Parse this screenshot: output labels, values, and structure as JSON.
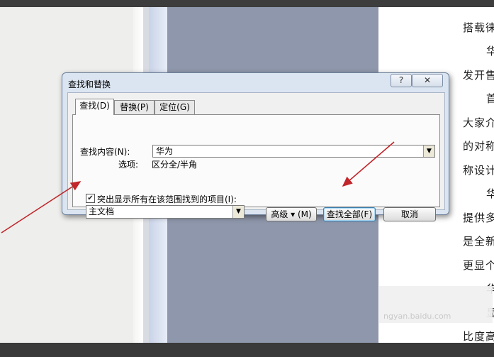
{
  "dialog": {
    "title": "查找和替换",
    "help_label": "?",
    "close_label": "✕",
    "tabs": [
      {
        "label": "查找(D)",
        "selected": true
      },
      {
        "label": "替换(P)",
        "selected": false
      },
      {
        "label": "定位(G)",
        "selected": false
      }
    ],
    "find_label": "查找内容(N):",
    "find_value": "华为",
    "options_label": "选项:",
    "options_value": "区分全/半角",
    "highlight_checkbox_label": "突出显示所有在该范围找到的项目(I):",
    "highlight_checked": true,
    "scope_value": "主文档",
    "buttons": {
      "advanced": "高级 ▾ (M)",
      "find_all": "查找全部(F)",
      "cancel": "取消"
    }
  },
  "document": {
    "lines": [
      "搭载徕",
      "华",
      "发开售",
      "首",
      "大家介",
      "的对称",
      "称设计",
      "华",
      "提供多",
      "是全新",
      "更显个",
      "华",
      "显",
      "比度高"
    ]
  },
  "watermark": "ngyan.baidu.com",
  "colors": {
    "annotation_arrow": "#c0262b"
  }
}
